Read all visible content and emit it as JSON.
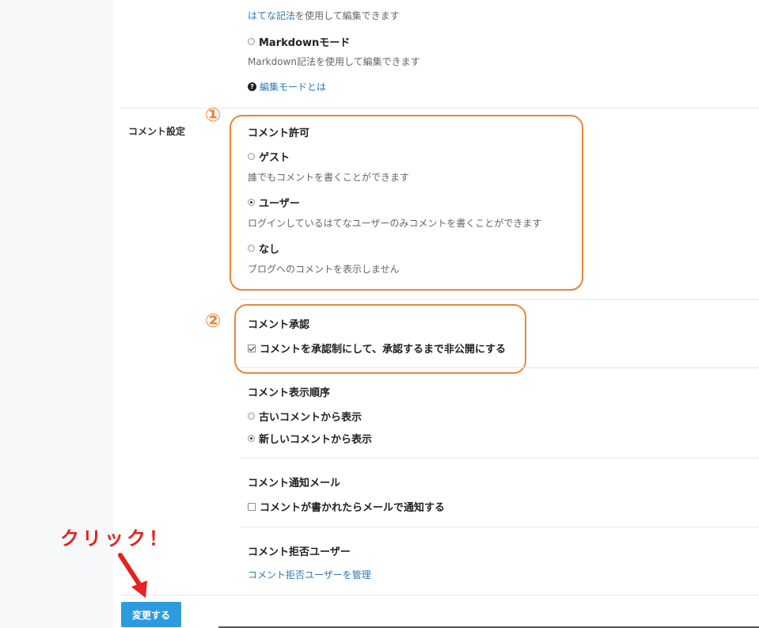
{
  "editor_mode": {
    "hatena_link": "はてな記法",
    "hatena_desc_rest": "を使用して編集できます",
    "markdown_label": "Markdownモード",
    "markdown_desc": "Markdown記法を使用して編集できます",
    "help_link": "編集モードとは"
  },
  "comment_settings": {
    "section_label": "コメント設定",
    "permission": {
      "title": "コメント許可",
      "options": [
        {
          "label": "ゲスト",
          "desc": "誰でもコメントを書くことができます",
          "checked": false
        },
        {
          "label": "ユーザー",
          "desc": "ログインしているはてなユーザーのみコメントを書くことができます",
          "checked": true
        },
        {
          "label": "なし",
          "desc": "ブログへのコメントを表示しません",
          "checked": false
        }
      ]
    },
    "approval": {
      "title": "コメント承認",
      "checkbox_label": "コメントを承認制にして、承認するまで非公開にする",
      "checked": true
    },
    "order": {
      "title": "コメント表示順序",
      "options": [
        {
          "label": "古いコメントから表示",
          "checked": false
        },
        {
          "label": "新しいコメントから表示",
          "checked": true
        }
      ]
    },
    "notify": {
      "title": "コメント通知メール",
      "checkbox_label": "コメントが書かれたらメールで通知する",
      "checked": false
    },
    "blocked": {
      "title": "コメント拒否ユーザー",
      "link": "コメント拒否ユーザーを管理"
    }
  },
  "annotations": {
    "marker1": "①",
    "marker2": "②",
    "click": "クリック！",
    "accent_color": "#e8873a",
    "click_color": "#e82020"
  },
  "submit_label": "変更する",
  "colors": {
    "link": "#2a7ab5",
    "button": "#2d9be0",
    "sidebar": "#f6f8fa"
  }
}
